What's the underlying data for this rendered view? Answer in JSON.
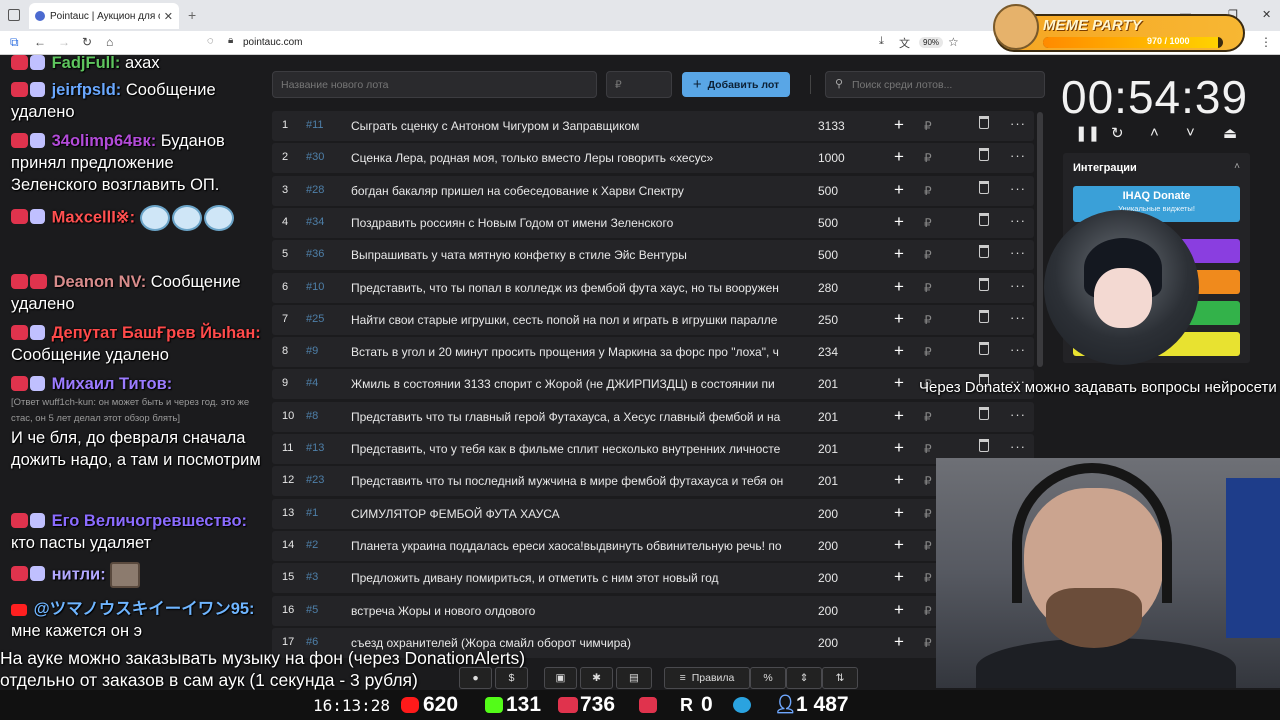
{
  "browser": {
    "tab_title": "Pointauc | Аукцион для стриме",
    "url": "pointauc.com",
    "zoom": "90%"
  },
  "chat": [
    {
      "name": "FadjFull:",
      "name_color": "#5ec55e",
      "text": "ахах"
    },
    {
      "name": "jeirfpsld:",
      "name_color": "#6aa8ff",
      "text": "Сообщение удалено"
    },
    {
      "name": "34olimp64вк:",
      "name_color": "#b24bd8",
      "text": "Буданов принял предложение Зеленского возглавить ОП."
    },
    {
      "name": "MaxcellI※:",
      "name_color": "#ff5050",
      "text": ""
    },
    {
      "name": "Deanon NV:",
      "name_color": "#d88c8c",
      "text": "Сообщение удалено"
    },
    {
      "name": "Депутат БашҒрев Йыhан:",
      "name_color": "#ff4a4a",
      "text": "Сообщение удалено"
    },
    {
      "name": "Михаил Титов:",
      "name_color": "#9b7bff",
      "reply": "[Ответ wuff1ch-kun: он может быть и через год. это же стас, он 5 лет делал этот обзор блять]",
      "text": "И че бля, до февраля сначала дожить надо, а там и посмотрим"
    },
    {
      "name": "Его Величогревшество:",
      "name_color": "#8b6cff",
      "text": "кто пасты удаляет"
    },
    {
      "name": "нитли:",
      "name_color": "#b2a8ff",
      "text": ""
    },
    {
      "name": "@ツマノウスキイーイワン95:",
      "name_color": "#6fb5ff",
      "text": "мне кажется он э"
    }
  ],
  "toolbar": {
    "new_lot_placeholder": "Название нового лота",
    "amount_placeholder": "₽",
    "add_button": "Добавить лот",
    "search_placeholder": "Поиск среди лотов..."
  },
  "lots": [
    {
      "idx": "1",
      "id": "#11",
      "name": "Сыграть сценку с Антоном Чигуром и Заправщиком",
      "amount": "3133"
    },
    {
      "idx": "2",
      "id": "#30",
      "name": "Сценка Лера, родная моя, только вместо Леры говорить «хесус»",
      "amount": "1000"
    },
    {
      "idx": "3",
      "id": "#28",
      "name": "богдан бакаляр пришел на собеседование к Харви Спектру",
      "amount": "500"
    },
    {
      "idx": "4",
      "id": "#34",
      "name": "Поздравить россиян с Новым Годом от имени Зеленского",
      "amount": "500"
    },
    {
      "idx": "5",
      "id": "#36",
      "name": "Выпрашивать у чата мятную конфетку в стиле Эйс Вентуры",
      "amount": "500"
    },
    {
      "idx": "6",
      "id": "#10",
      "name": "Представить, что ты попал в колледж из фембой футa хаус, но ты вооружен",
      "amount": "280"
    },
    {
      "idx": "7",
      "id": "#25",
      "name": "Найти свои старые игрушки, сесть попой на пол и играть в игрушки паралле",
      "amount": "250"
    },
    {
      "idx": "8",
      "id": "#9",
      "name": "Встать в угол и 20 минут просить прощения у Маркина за форс про \"лоха\", ч",
      "amount": "234"
    },
    {
      "idx": "9",
      "id": "#4",
      "name": "Жмиль в состоянии 3133 спорит с Жорой (не ДЖИРПИЗДЦ) в состоянии пи",
      "amount": "201"
    },
    {
      "idx": "10",
      "id": "#8",
      "name": "Представить что ты главный герой Футахауса, а Хесус главный фембой и на",
      "amount": "201"
    },
    {
      "idx": "11",
      "id": "#13",
      "name": "Представить, что у тебя как в фильме сплит несколько внутренних личносте",
      "amount": "201"
    },
    {
      "idx": "12",
      "id": "#23",
      "name": "Представить что ты последний мужчина в мире фембой футахауса и тебя он",
      "amount": "201"
    },
    {
      "idx": "13",
      "id": "#1",
      "name": "СИМУЛЯТОР ФЕМБОЙ ФУТА ХАУСА",
      "amount": "200"
    },
    {
      "idx": "14",
      "id": "#2",
      "name": "Планета украина поддалась ереси хаоса!выдвинуть обвинительную речь! по",
      "amount": "200"
    },
    {
      "idx": "15",
      "id": "#3",
      "name": "Предложить дивану помириться, и отметить с ним этот новый год",
      "amount": "200"
    },
    {
      "idx": "16",
      "id": "#5",
      "name": "встреча Жоры и нового олдового",
      "amount": "200"
    },
    {
      "idx": "17",
      "id": "#6",
      "name": "съезд охранителей (Жора смайл оборот чимчира)",
      "amount": "200"
    }
  ],
  "bottom_toolbar": {
    "rules_label": "Правила"
  },
  "timer": {
    "value": "00:54:39"
  },
  "integrations": {
    "title": "Интеграции",
    "donate_label": "IHAQ Donate",
    "donate_sub": "Уникальные виджеты!",
    "btn_colors": [
      "#8a3ee0",
      "#f08a1c",
      "#33b24a",
      "#e8e230"
    ]
  },
  "captions": {
    "right": "Через Donatex можно задавать вопросы нейросети",
    "bottom_line1": "На ауке можно заказывать музыку на фон (через DonationAlerts)",
    "bottom_line2": "отдельно от заказов в сам аук (1 секунда - 3 рубля)"
  },
  "meme_party": {
    "title": "MEME PARTY",
    "count": "970 / 1000",
    "progress": 0.97
  },
  "stats": {
    "clock": "16:13:28",
    "youtube": "620",
    "kick": "131",
    "live": "736",
    "rutube": "0",
    "telegram": "1 487"
  }
}
